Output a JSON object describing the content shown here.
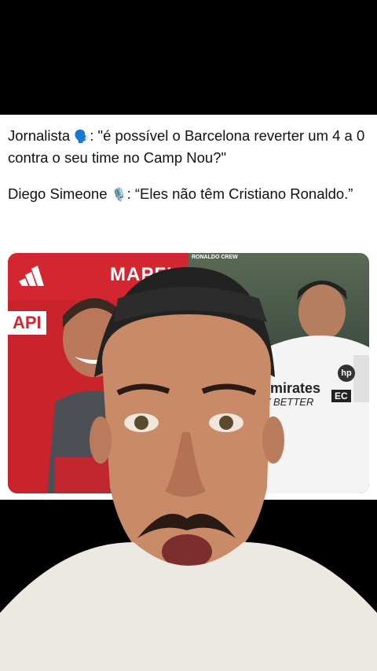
{
  "tweet": {
    "line1_speaker": "Jornalista",
    "line1_emoji": "🗣️",
    "line1_quote": ": \"é possível o Barcelona reverter um 4 a 0 contra o seu time no Camp Nou?\"",
    "line2_speaker": "Diego Simeone",
    "line2_emoji": "🎙️",
    "line2_quote": ": “Eles não têm Cristiano Ronaldo.”"
  },
  "photo": {
    "left_sponsor": "MAPFI",
    "left_side_text": "API",
    "right_tag": "RONALDO CREW",
    "shirt_sponsor": "Emirates",
    "shirt_slogan": "Y BETTER",
    "hp_logo": "hp",
    "captain_band": "EC"
  },
  "icons": [
    "speaking-head-icon",
    "microphone-icon",
    "adidas-logo-icon"
  ]
}
